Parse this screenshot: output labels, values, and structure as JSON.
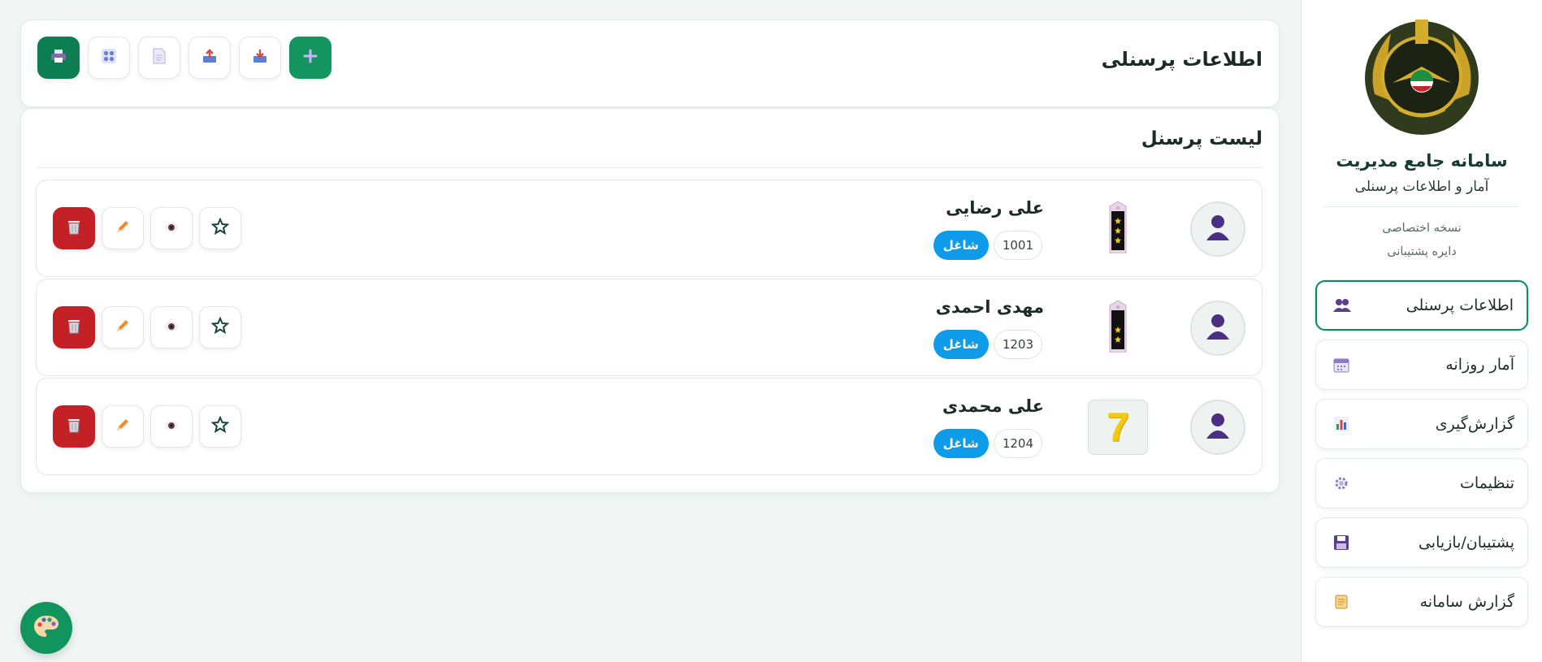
{
  "sidebar": {
    "system_title": "سامانه جامع مدیریت",
    "system_subtitle": "آمار و اطلاعات پرسنلی",
    "edition": "نسخه اختصاصی",
    "department": "دایره پشتیبانی",
    "nav": [
      {
        "label": "اطلاعات پرسنلی",
        "icon": "people-icon",
        "active": true
      },
      {
        "label": "آمار روزانه",
        "icon": "calendar-icon",
        "active": false
      },
      {
        "label": "گزارش‌گیری",
        "icon": "bar-chart-icon",
        "active": false
      },
      {
        "label": "تنظیمات",
        "icon": "gear-icon",
        "active": false
      },
      {
        "label": "پشتیبان/بازیابی",
        "icon": "floppy-disk-icon",
        "active": false
      },
      {
        "label": "گزارش سامانه",
        "icon": "scroll-icon",
        "active": false
      }
    ]
  },
  "header": {
    "title": "اطلاعات پرسنلی",
    "toolbar": [
      "add-icon",
      "inbox-tray-icon",
      "outbox-tray-icon",
      "document-icon",
      "grid-icon",
      "printer-icon"
    ]
  },
  "list": {
    "title": "لیست پرسنل",
    "people": [
      {
        "name": "علی رضایی",
        "id": "1001",
        "status": "شاغل",
        "rank_icon": "epaulette-three-stars-icon"
      },
      {
        "name": "مهدی احمدی",
        "id": "1203",
        "status": "شاغل",
        "rank_icon": "epaulette-two-stars-icon"
      },
      {
        "name": "علی محمدی",
        "id": "1204",
        "status": "شاغل",
        "rank_icon": "number-seven-icon",
        "rank_text": "7"
      }
    ]
  },
  "colors": {
    "accent": "#0f8a5f",
    "status": "#0d9bea",
    "delete": "#c42127"
  }
}
